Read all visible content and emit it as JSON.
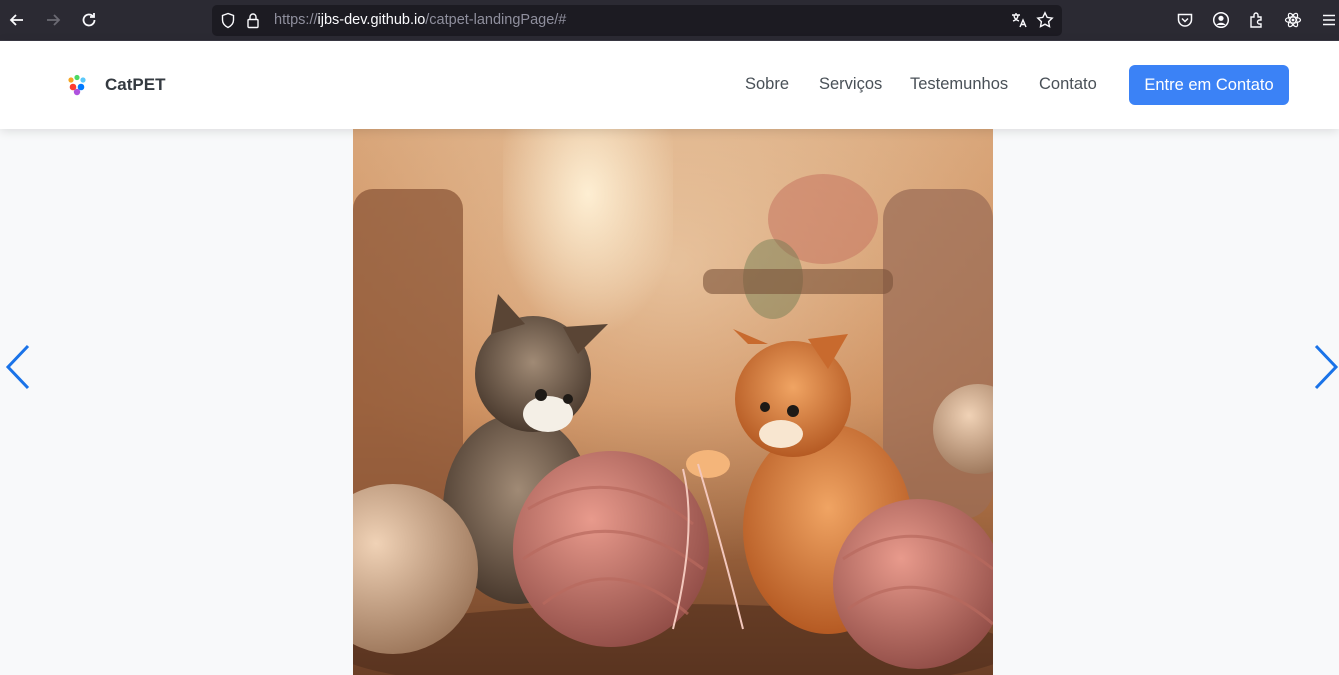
{
  "browser": {
    "url_prefix": "https://",
    "url_domain": "ijbs-dev.github.io",
    "url_path": "/catpet-landingPage/#"
  },
  "header": {
    "brand": "CatPET",
    "nav": [
      {
        "label": "Sobre"
      },
      {
        "label": "Serviços"
      },
      {
        "label": "Testemunhos"
      },
      {
        "label": "Contato"
      }
    ],
    "cta_label": "Entre em Contato"
  },
  "colors": {
    "accent": "#3b82f6",
    "arrow": "#1a73e8"
  },
  "carousel": {
    "slide_alt": "kittens-playing-with-yarn",
    "prev_icon": "chevron-left-icon",
    "next_icon": "chevron-right-icon"
  }
}
